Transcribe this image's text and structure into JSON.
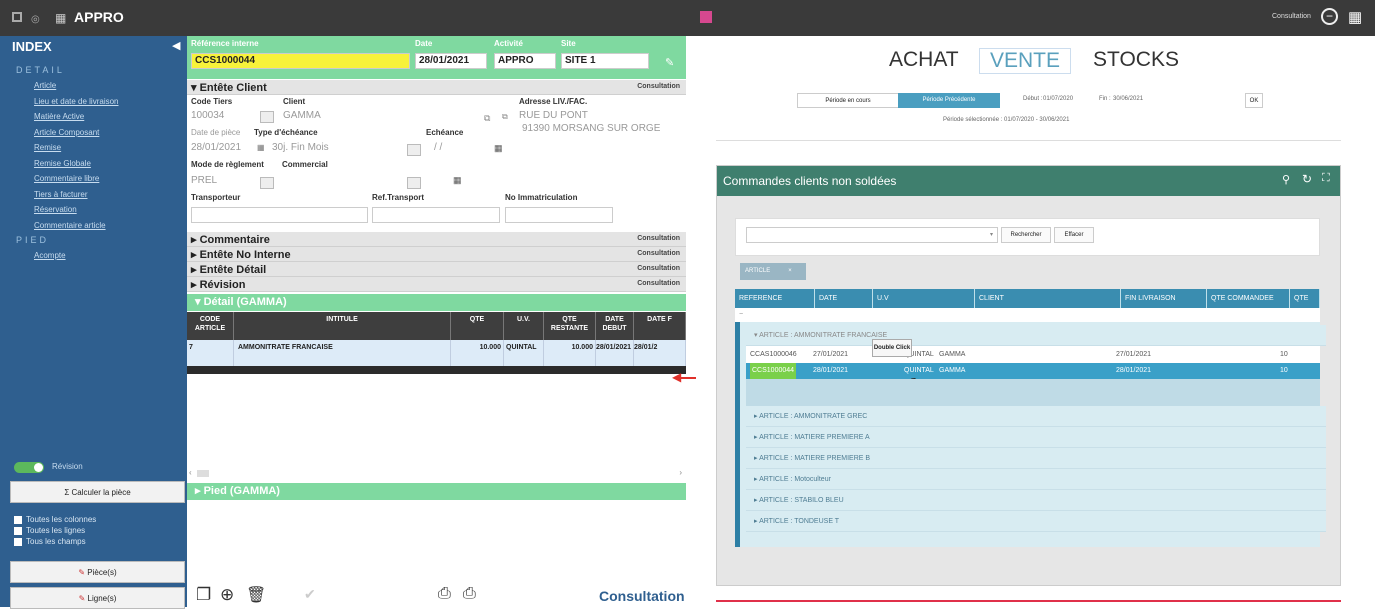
{
  "window": {
    "title": "APPRO",
    "mode": "Consultation"
  },
  "sidebar": {
    "title": "INDEX",
    "detail_section": "DETAIL",
    "detail_items": [
      "Article",
      "Lieu et date de livraison",
      "Matière Active",
      "Article Composant",
      "Remise",
      "Remise Globale",
      "Commentaire libre",
      "Tiers à facturer",
      "Réservation",
      "Commentaire article"
    ],
    "pied_section": "PIED",
    "pied_items": [
      "Acompte"
    ],
    "revision_label": "Révision",
    "calc_button": "Calculer la pièce",
    "options": [
      "Toutes les colonnes",
      "Toutes les lignes",
      "Tous les champs"
    ],
    "pieces_button": "Pièce(s)",
    "lignes_button": "Ligne(s)"
  },
  "header": {
    "ref_label": "Référence interne",
    "ref_value": "CCS1000044",
    "date_label": "Date",
    "date_value": "28/01/2021",
    "activite_label": "Activité",
    "activite_value": "APPRO",
    "site_label": "Site",
    "site_value": "SITE 1"
  },
  "entete": {
    "title": "▾ Entête Client",
    "status": "Consultation",
    "code_tiers_label": "Code Tiers",
    "code_tiers_value": "100034",
    "client_label": "Client",
    "client_value": "GAMMA",
    "adresse_label": "Adresse LIV./FAC.",
    "adresse_line1": "RUE DU PONT",
    "adresse_line2": "91390  MORSANG SUR ORGE",
    "date_piece_label": "Date de pièce",
    "date_piece_value": "28/01/2021",
    "type_echeance_label": "Type d'échéance",
    "type_echeance_value": "30j. Fin Mois",
    "echeance_label": "Echéance",
    "echeance_value": "/ /",
    "mode_reglement_label": "Mode de règlement",
    "mode_reglement_value": "PREL",
    "commercial_label": "Commercial",
    "transporteur_label": "Transporteur",
    "ref_transport_label": "Ref.Transport",
    "immatriculation_label": "No Immatriculation"
  },
  "sections": [
    {
      "title": "▸ Commentaire",
      "status": "Consultation"
    },
    {
      "title": "▸ Entête No Interne",
      "status": "Consultation"
    },
    {
      "title": "▸ Entête Détail",
      "status": "Consultation"
    },
    {
      "title": "▸ Révision",
      "status": "Consultation"
    }
  ],
  "detail": {
    "title": "▾ Détail (GAMMA)",
    "columns": [
      "CODE ARTICLE",
      "INTITULE",
      "QTE",
      "U.V.",
      "QTE RESTANTE",
      "DATE DEBUT",
      "DATE F"
    ],
    "rows": [
      {
        "code": "7",
        "intitule": "AMMONITRATE FRANCAISE",
        "qte": "10.000",
        "uv": "QUINTAL",
        "qte_restante": "10.000",
        "date_debut": "28/01/2021",
        "date_fin": "28/01/2"
      }
    ]
  },
  "pied": {
    "title": "▸ Pied (GAMMA)"
  },
  "footer": {
    "status": "Consultation"
  },
  "right": {
    "tabs": [
      "ACHAT",
      "VENTE",
      "STOCKS"
    ],
    "active_tab": "VENTE",
    "period_buttons": [
      "Période en cours",
      "Période Précédente"
    ],
    "debut_label": "Début :",
    "debut_value": "01/07/2020",
    "fin_label": "Fin :",
    "fin_value": "30/06/2021",
    "ok_label": "OK",
    "periode_selection": "Période sélectionnée : 01/07/2020 - 30/06/2021",
    "widget_title": "Commandes clients non soldées",
    "search_button": "Rechercher",
    "clear_button": "Effacer",
    "filter_chip": "ARTICLE",
    "table_columns": [
      "REFERENCE",
      "DATE",
      "U.V",
      "CLIENT",
      "FIN LIVRAISON",
      "QTE COMMANDEE",
      "QTE"
    ],
    "group_expanded": "ARTICLE : AMMONITRATE FRANCAISE",
    "rows": [
      {
        "reference": "CCAS1000046",
        "date": "27/01/2021",
        "uv": "QUINTAL",
        "client": "GAMMA",
        "fin": "27/01/2021",
        "qte": "10"
      },
      {
        "reference": "CCS1000044",
        "date": "28/01/2021",
        "uv": "QUINTAL",
        "client": "GAMMA",
        "fin": "28/01/2021",
        "qte": "10"
      }
    ],
    "tooltip": "Double Click",
    "groups": [
      "ARTICLE : AMMONITRATE GREC",
      "ARTICLE : MATIERE PREMIERE A",
      "ARTICLE : MATIERE PREMIERE B",
      "ARTICLE : Motoculteur",
      "ARTICLE : STABILO BLEU",
      "ARTICLE : TONDEUSE T"
    ]
  }
}
